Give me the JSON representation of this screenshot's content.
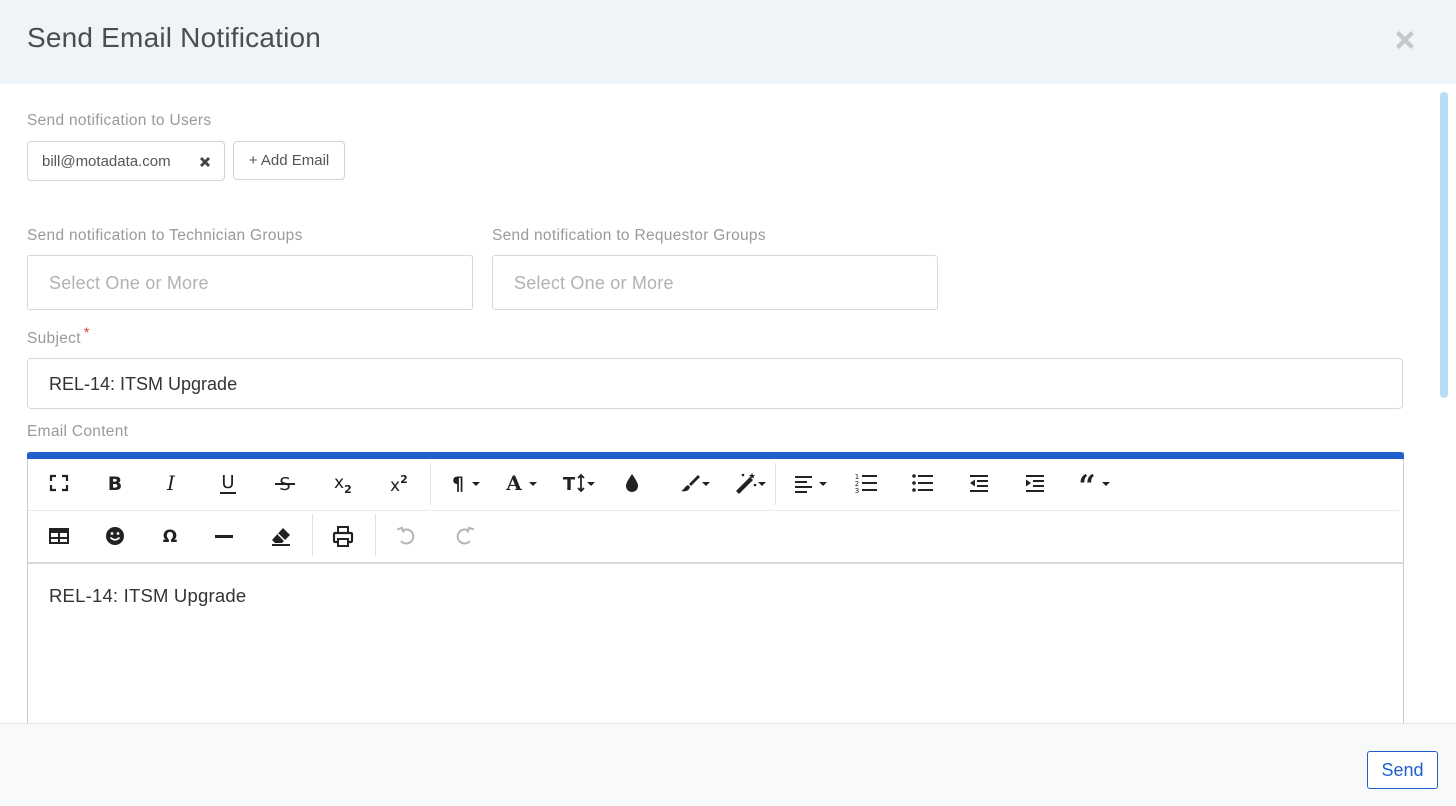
{
  "dialog": {
    "title": "Send Email Notification"
  },
  "users": {
    "label": "Send notification to Users",
    "chips": [
      {
        "email": "bill@motadata.com"
      }
    ],
    "add_email_label": "+ Add Email"
  },
  "technician_groups": {
    "label": "Send notification to Technician Groups",
    "placeholder": "Select One or More"
  },
  "requestor_groups": {
    "label": "Send notification to Requestor Groups",
    "placeholder": "Select One or More"
  },
  "subject": {
    "label": "Subject",
    "required_mark": "*",
    "value": "REL-14: ITSM Upgrade"
  },
  "email_content": {
    "label": "Email Content",
    "body": "REL-14: ITSM Upgrade",
    "toolbar_icons": [
      "fullscreen-icon",
      "bold-icon",
      "italic-icon",
      "underline-icon",
      "strikethrough-icon",
      "subscript-icon",
      "superscript-icon",
      "paragraph-format-icon",
      "font-family-icon",
      "font-size-icon",
      "color-drop-icon",
      "paint-brush-icon",
      "magic-wand-icon",
      "align-icon",
      "ordered-list-icon",
      "unordered-list-icon",
      "outdent-icon",
      "indent-icon",
      "quote-icon",
      "table-icon",
      "emoticon-icon",
      "special-character-icon",
      "horizontal-line-icon",
      "clear-formatting-icon",
      "print-icon",
      "undo-icon",
      "redo-icon"
    ]
  },
  "footer": {
    "send_label": "Send"
  },
  "colors": {
    "accent": "#1e5fcc",
    "header_bg": "#eff4f8",
    "required": "#e0342a"
  }
}
